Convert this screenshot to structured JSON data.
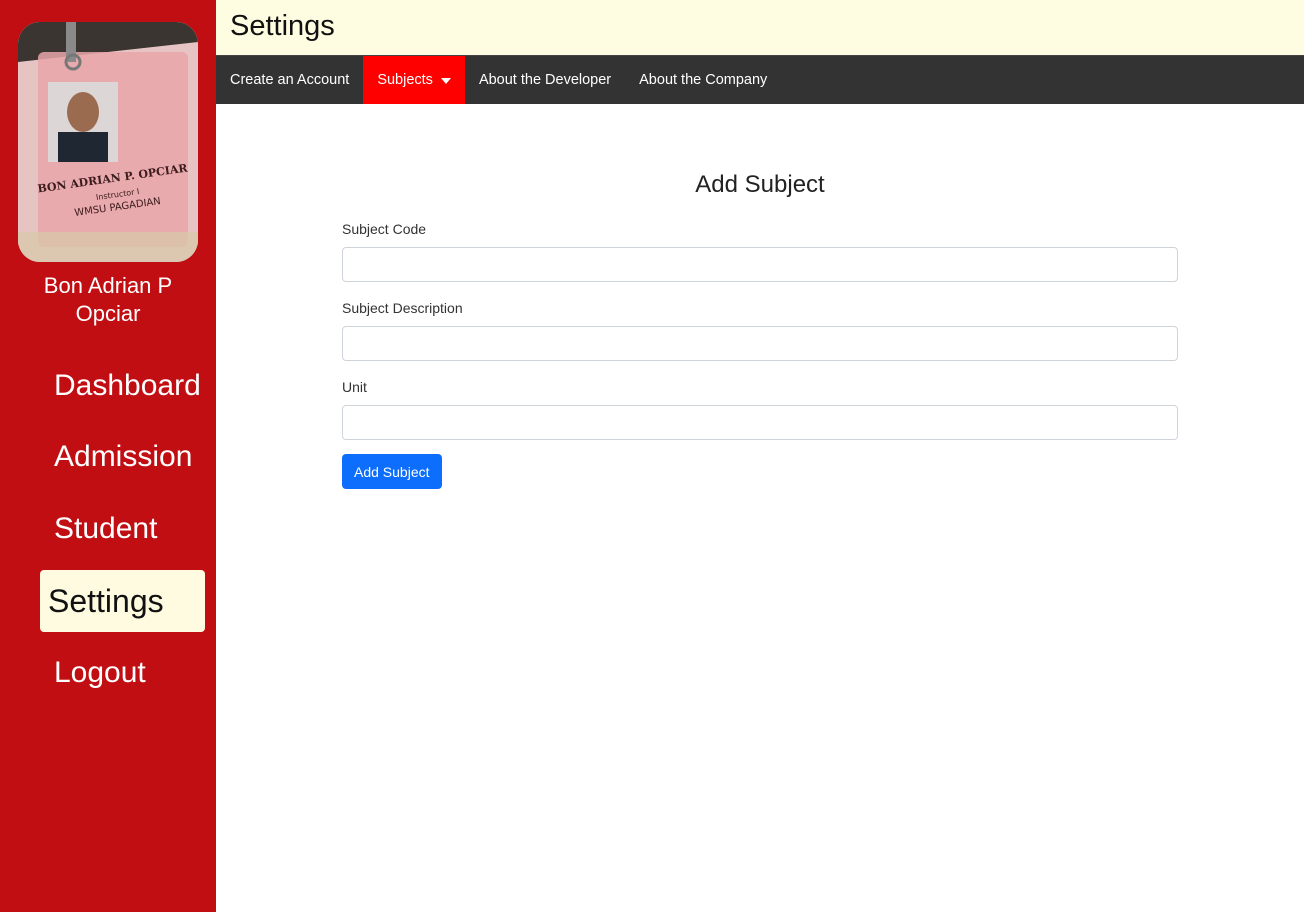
{
  "sidebar": {
    "user_name": "Bon Adrian P Opciar",
    "avatar_icon": "id-card-photo",
    "items": [
      {
        "label": "Dashboard",
        "active": false
      },
      {
        "label": "Admission",
        "active": false
      },
      {
        "label": "Student",
        "active": false
      },
      {
        "label": "Settings",
        "active": true
      },
      {
        "label": "Logout",
        "active": false
      }
    ]
  },
  "header": {
    "title": "Settings"
  },
  "menu": {
    "items": [
      {
        "label": "Create an Account",
        "active": false
      },
      {
        "label": "Subjects",
        "active": true,
        "dropdown_icon": "caret-down-icon"
      },
      {
        "label": "About the Developer",
        "active": false
      },
      {
        "label": "About the Company",
        "active": false
      }
    ]
  },
  "form": {
    "title": "Add Subject",
    "fields": [
      {
        "label": "Subject Code",
        "value": ""
      },
      {
        "label": "Subject Description",
        "value": ""
      },
      {
        "label": "Unit",
        "value": ""
      }
    ],
    "submit_label": "Add Subject"
  },
  "colors": {
    "sidebar_bg": "#c10e12",
    "header_bg": "#fffde1",
    "menubar_bg": "#333333",
    "menu_active": "#ff0000",
    "primary_button": "#0d6efd",
    "active_nav_bg": "#fffbe1"
  }
}
